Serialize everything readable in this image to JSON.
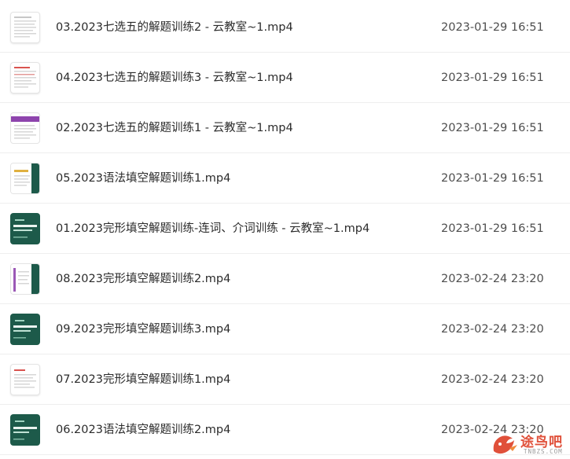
{
  "files": [
    {
      "name": "03.2023七选五的解题训练2 - 云教室~1.mp4",
      "modified": "2023-01-29 16:51",
      "thumb_icon": "document-thumbnail-icon"
    },
    {
      "name": "04.2023七选五的解题训练3 - 云教室~1.mp4",
      "modified": "2023-01-29 16:51",
      "thumb_icon": "document-thumbnail-icon"
    },
    {
      "name": "02.2023七选五的解题训练1 - 云教室~1.mp4",
      "modified": "2023-01-29 16:51",
      "thumb_icon": "slide-thumbnail-icon"
    },
    {
      "name": "05.2023语法填空解题训练1.mp4",
      "modified": "2023-01-29 16:51",
      "thumb_icon": "slide-thumbnail-icon"
    },
    {
      "name": "01.2023完形填空解题训练-连词、介词训练 - 云教室~1.mp4",
      "modified": "2023-01-29 16:51",
      "thumb_icon": "cover-thumbnail-icon"
    },
    {
      "name": "08.2023完形填空解题训练2.mp4",
      "modified": "2023-02-24 23:20",
      "thumb_icon": "slide-thumbnail-icon"
    },
    {
      "name": "09.2023完形填空解题训练3.mp4",
      "modified": "2023-02-24 23:20",
      "thumb_icon": "cover-thumbnail-icon"
    },
    {
      "name": "07.2023完形填空解题训练1.mp4",
      "modified": "2023-02-24 23:20",
      "thumb_icon": "document-thumbnail-icon"
    },
    {
      "name": "06.2023语法填空解题训练2.mp4",
      "modified": "2023-02-24 23:20",
      "thumb_icon": "cover-thumbnail-icon"
    }
  ],
  "watermark": {
    "title": "途鸟吧",
    "domain": "TNBZS.COM"
  },
  "colors": {
    "thumb_green": "#1d5a4a",
    "watermark_red": "#e0503a",
    "row_divider": "#eeeeee"
  }
}
